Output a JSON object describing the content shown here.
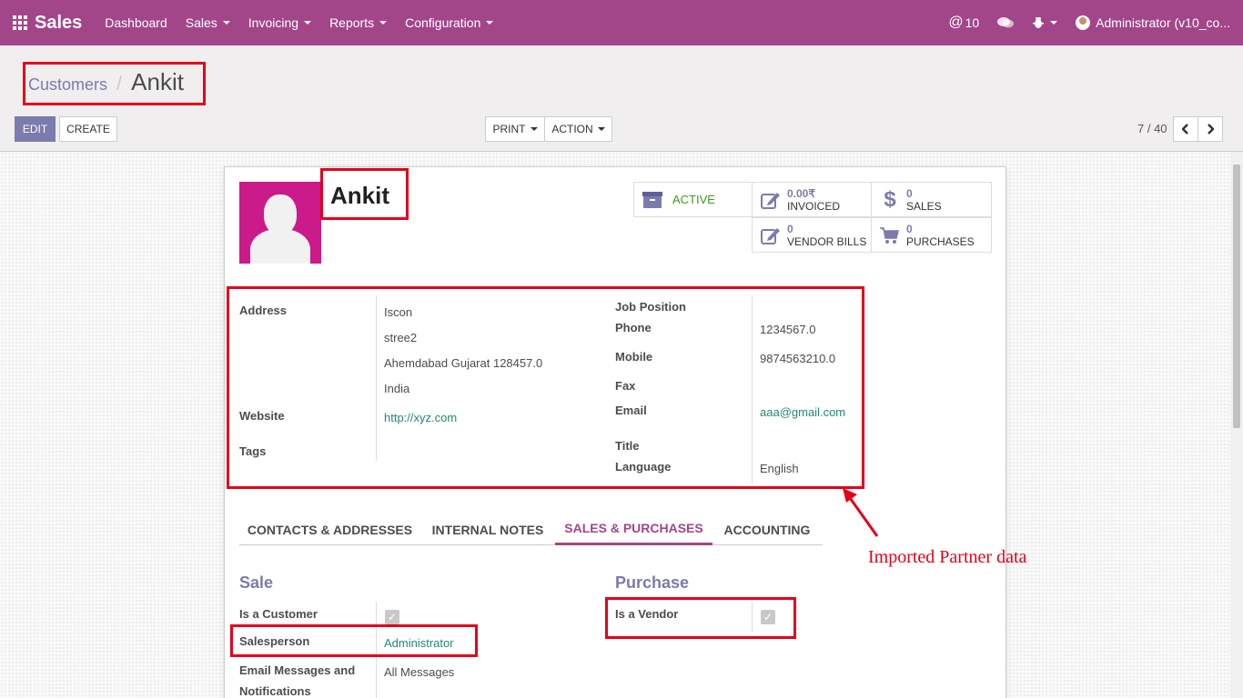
{
  "navbar": {
    "app_title": "Sales",
    "menu": [
      "Dashboard",
      "Sales",
      "Invoicing",
      "Reports",
      "Configuration"
    ],
    "mentions_count": "10",
    "user_label": "Administrator (v10_co..."
  },
  "breadcrumb": {
    "parent": "Customers",
    "separator": "/",
    "current": "Ankit"
  },
  "buttons": {
    "edit": "EDIT",
    "create": "CREATE",
    "print": "PRINT",
    "action": "ACTION"
  },
  "pager": {
    "text": "7 / 40"
  },
  "partner": {
    "name": "Ankit"
  },
  "stat_buttons": {
    "active": "ACTIVE",
    "invoiced_value": "0.00₹",
    "invoiced_label": "INVOICED",
    "sales_value": "0",
    "sales_label": "SALES",
    "vendor_bills_value": "0",
    "vendor_bills_label": "VENDOR BILLS",
    "purchases_value": "0",
    "purchases_label": "PURCHASES"
  },
  "fields": {
    "address_label": "Address",
    "address_lines": [
      "Iscon",
      "stree2",
      "Ahemdabad Gujarat 128457.0",
      "India"
    ],
    "website_label": "Website",
    "website": "http://xyz.com",
    "tags_label": "Tags",
    "job_position_label": "Job Position",
    "phone_label": "Phone",
    "phone": "1234567.0",
    "mobile_label": "Mobile",
    "mobile": "9874563210.0",
    "fax_label": "Fax",
    "email_label": "Email",
    "email": "aaa@gmail.com",
    "title_label": "Title",
    "language_label": "Language",
    "language": "English"
  },
  "tabs": [
    "CONTACTS & ADDRESSES",
    "INTERNAL NOTES",
    "SALES & PURCHASES",
    "ACCOUNTING"
  ],
  "sale": {
    "title": "Sale",
    "is_customer_label": "Is a Customer",
    "is_customer": true,
    "salesperson_label": "Salesperson",
    "salesperson": "Administrator",
    "email_messages_label_1": "Email Messages and",
    "email_messages_label_2": "Notifications",
    "email_messages": "All Messages"
  },
  "purchase": {
    "title": "Purchase",
    "is_vendor_label": "Is a Vendor",
    "is_vendor": true
  },
  "annotation": {
    "text": "Imported Partner data"
  },
  "colors": {
    "brand": "#a24689",
    "accent": "#7c7bad",
    "link": "#218a74",
    "annotation": "#e4001b"
  }
}
